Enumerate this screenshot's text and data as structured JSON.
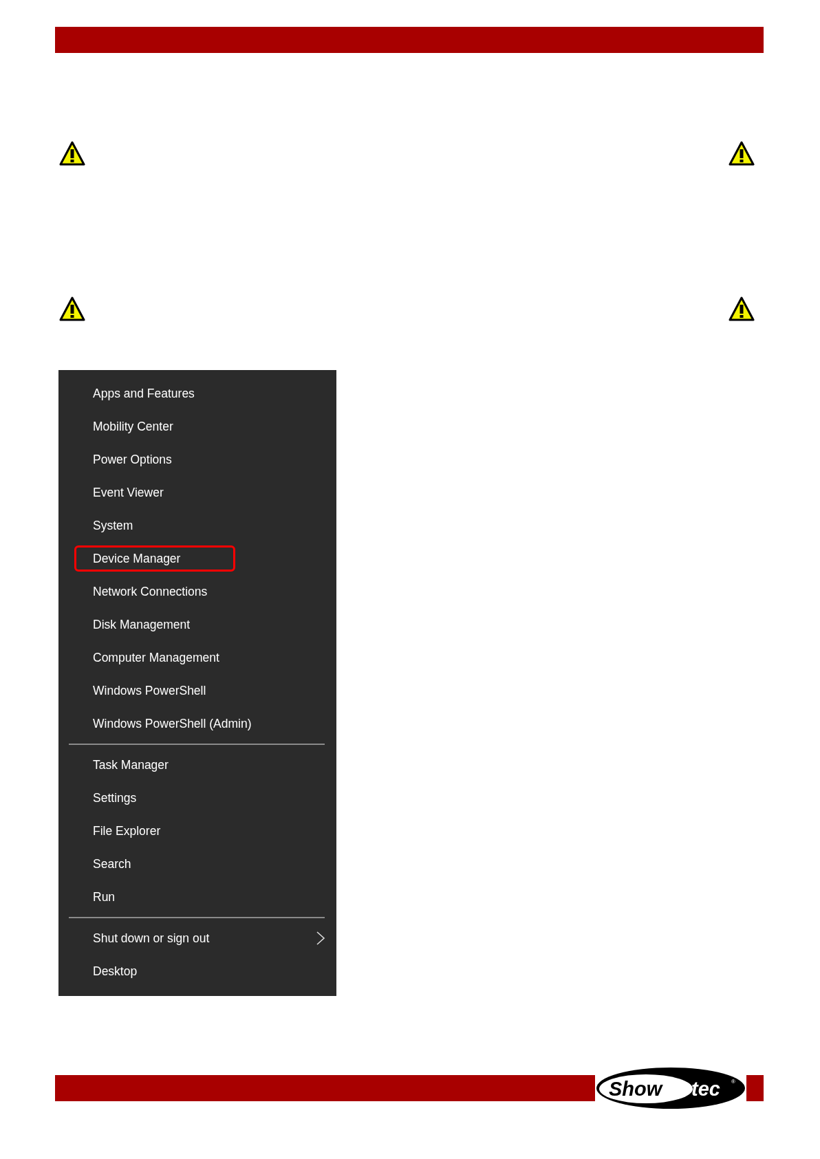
{
  "warnings": [
    {
      "kind": "warning"
    },
    {
      "kind": "warning"
    }
  ],
  "menu": {
    "sections": [
      {
        "items": [
          {
            "label": "Apps and Features",
            "highlighted": false,
            "submenu": false
          },
          {
            "label": "Mobility Center",
            "highlighted": false,
            "submenu": false
          },
          {
            "label": "Power Options",
            "highlighted": false,
            "submenu": false
          },
          {
            "label": "Event Viewer",
            "highlighted": false,
            "submenu": false
          },
          {
            "label": "System",
            "highlighted": false,
            "submenu": false
          },
          {
            "label": "Device Manager",
            "highlighted": true,
            "submenu": false
          },
          {
            "label": "Network Connections",
            "highlighted": false,
            "submenu": false
          },
          {
            "label": "Disk Management",
            "highlighted": false,
            "submenu": false
          },
          {
            "label": "Computer Management",
            "highlighted": false,
            "submenu": false
          },
          {
            "label": "Windows PowerShell",
            "highlighted": false,
            "submenu": false
          },
          {
            "label": "Windows PowerShell (Admin)",
            "highlighted": false,
            "submenu": false
          }
        ]
      },
      {
        "items": [
          {
            "label": "Task Manager",
            "highlighted": false,
            "submenu": false
          },
          {
            "label": "Settings",
            "highlighted": false,
            "submenu": false
          },
          {
            "label": "File Explorer",
            "highlighted": false,
            "submenu": false
          },
          {
            "label": "Search",
            "highlighted": false,
            "submenu": false
          },
          {
            "label": "Run",
            "highlighted": false,
            "submenu": false
          }
        ]
      },
      {
        "items": [
          {
            "label": "Shut down or sign out",
            "highlighted": false,
            "submenu": true
          },
          {
            "label": "Desktop",
            "highlighted": false,
            "submenu": false
          }
        ]
      }
    ]
  },
  "footer": {
    "logo": {
      "word_1": "Show",
      "word_2": "tec",
      "mark": "®"
    }
  }
}
